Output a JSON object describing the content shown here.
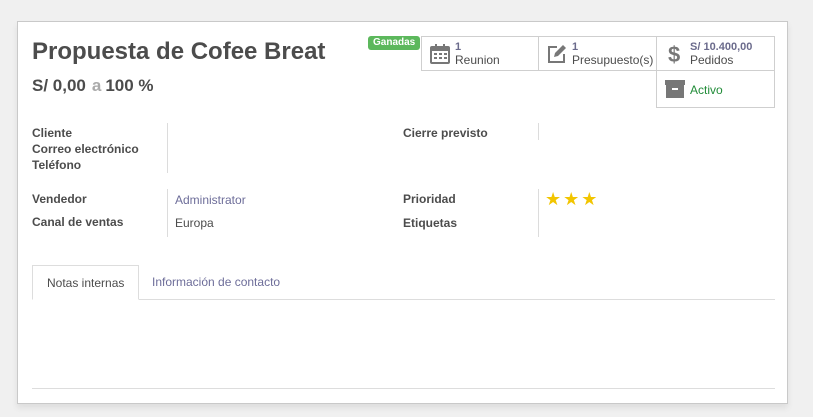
{
  "record": {
    "title": "Propuesta de Cofee Breat",
    "amount": "S/ 0,00",
    "amount_sep": "a",
    "probability": "100 %",
    "ribbon": "Ganadas"
  },
  "smart_buttons": [
    {
      "value": "1",
      "label": "Reunion",
      "icon": "calendar-icon"
    },
    {
      "value": "1",
      "label": "Presupuesto(s)",
      "icon": "edit-icon"
    },
    {
      "value": "S/ 10.400,00",
      "label": "Pedidos",
      "icon": "dollar-icon"
    },
    {
      "label": "Activo",
      "icon": "archive-icon"
    }
  ],
  "fields": {
    "cliente": "Cliente",
    "correo": "Correo electrónico",
    "telefono": "Teléfono",
    "cierre": "Cierre previsto",
    "vendedor": "Vendedor",
    "vendedor_value": "Administrator",
    "canal": "Canal de ventas",
    "canal_value": "Europa",
    "prioridad": "Prioridad",
    "prioridad_stars": 3,
    "etiquetas": "Etiquetas"
  },
  "tabs": [
    {
      "label": "Notas internas",
      "active": true
    },
    {
      "label": "Información de contacto",
      "active": false
    }
  ],
  "colors": {
    "ribbon": "#5cb85c",
    "star": "#f2c500",
    "active_status": "#218c38",
    "link": "#6d6d99"
  }
}
